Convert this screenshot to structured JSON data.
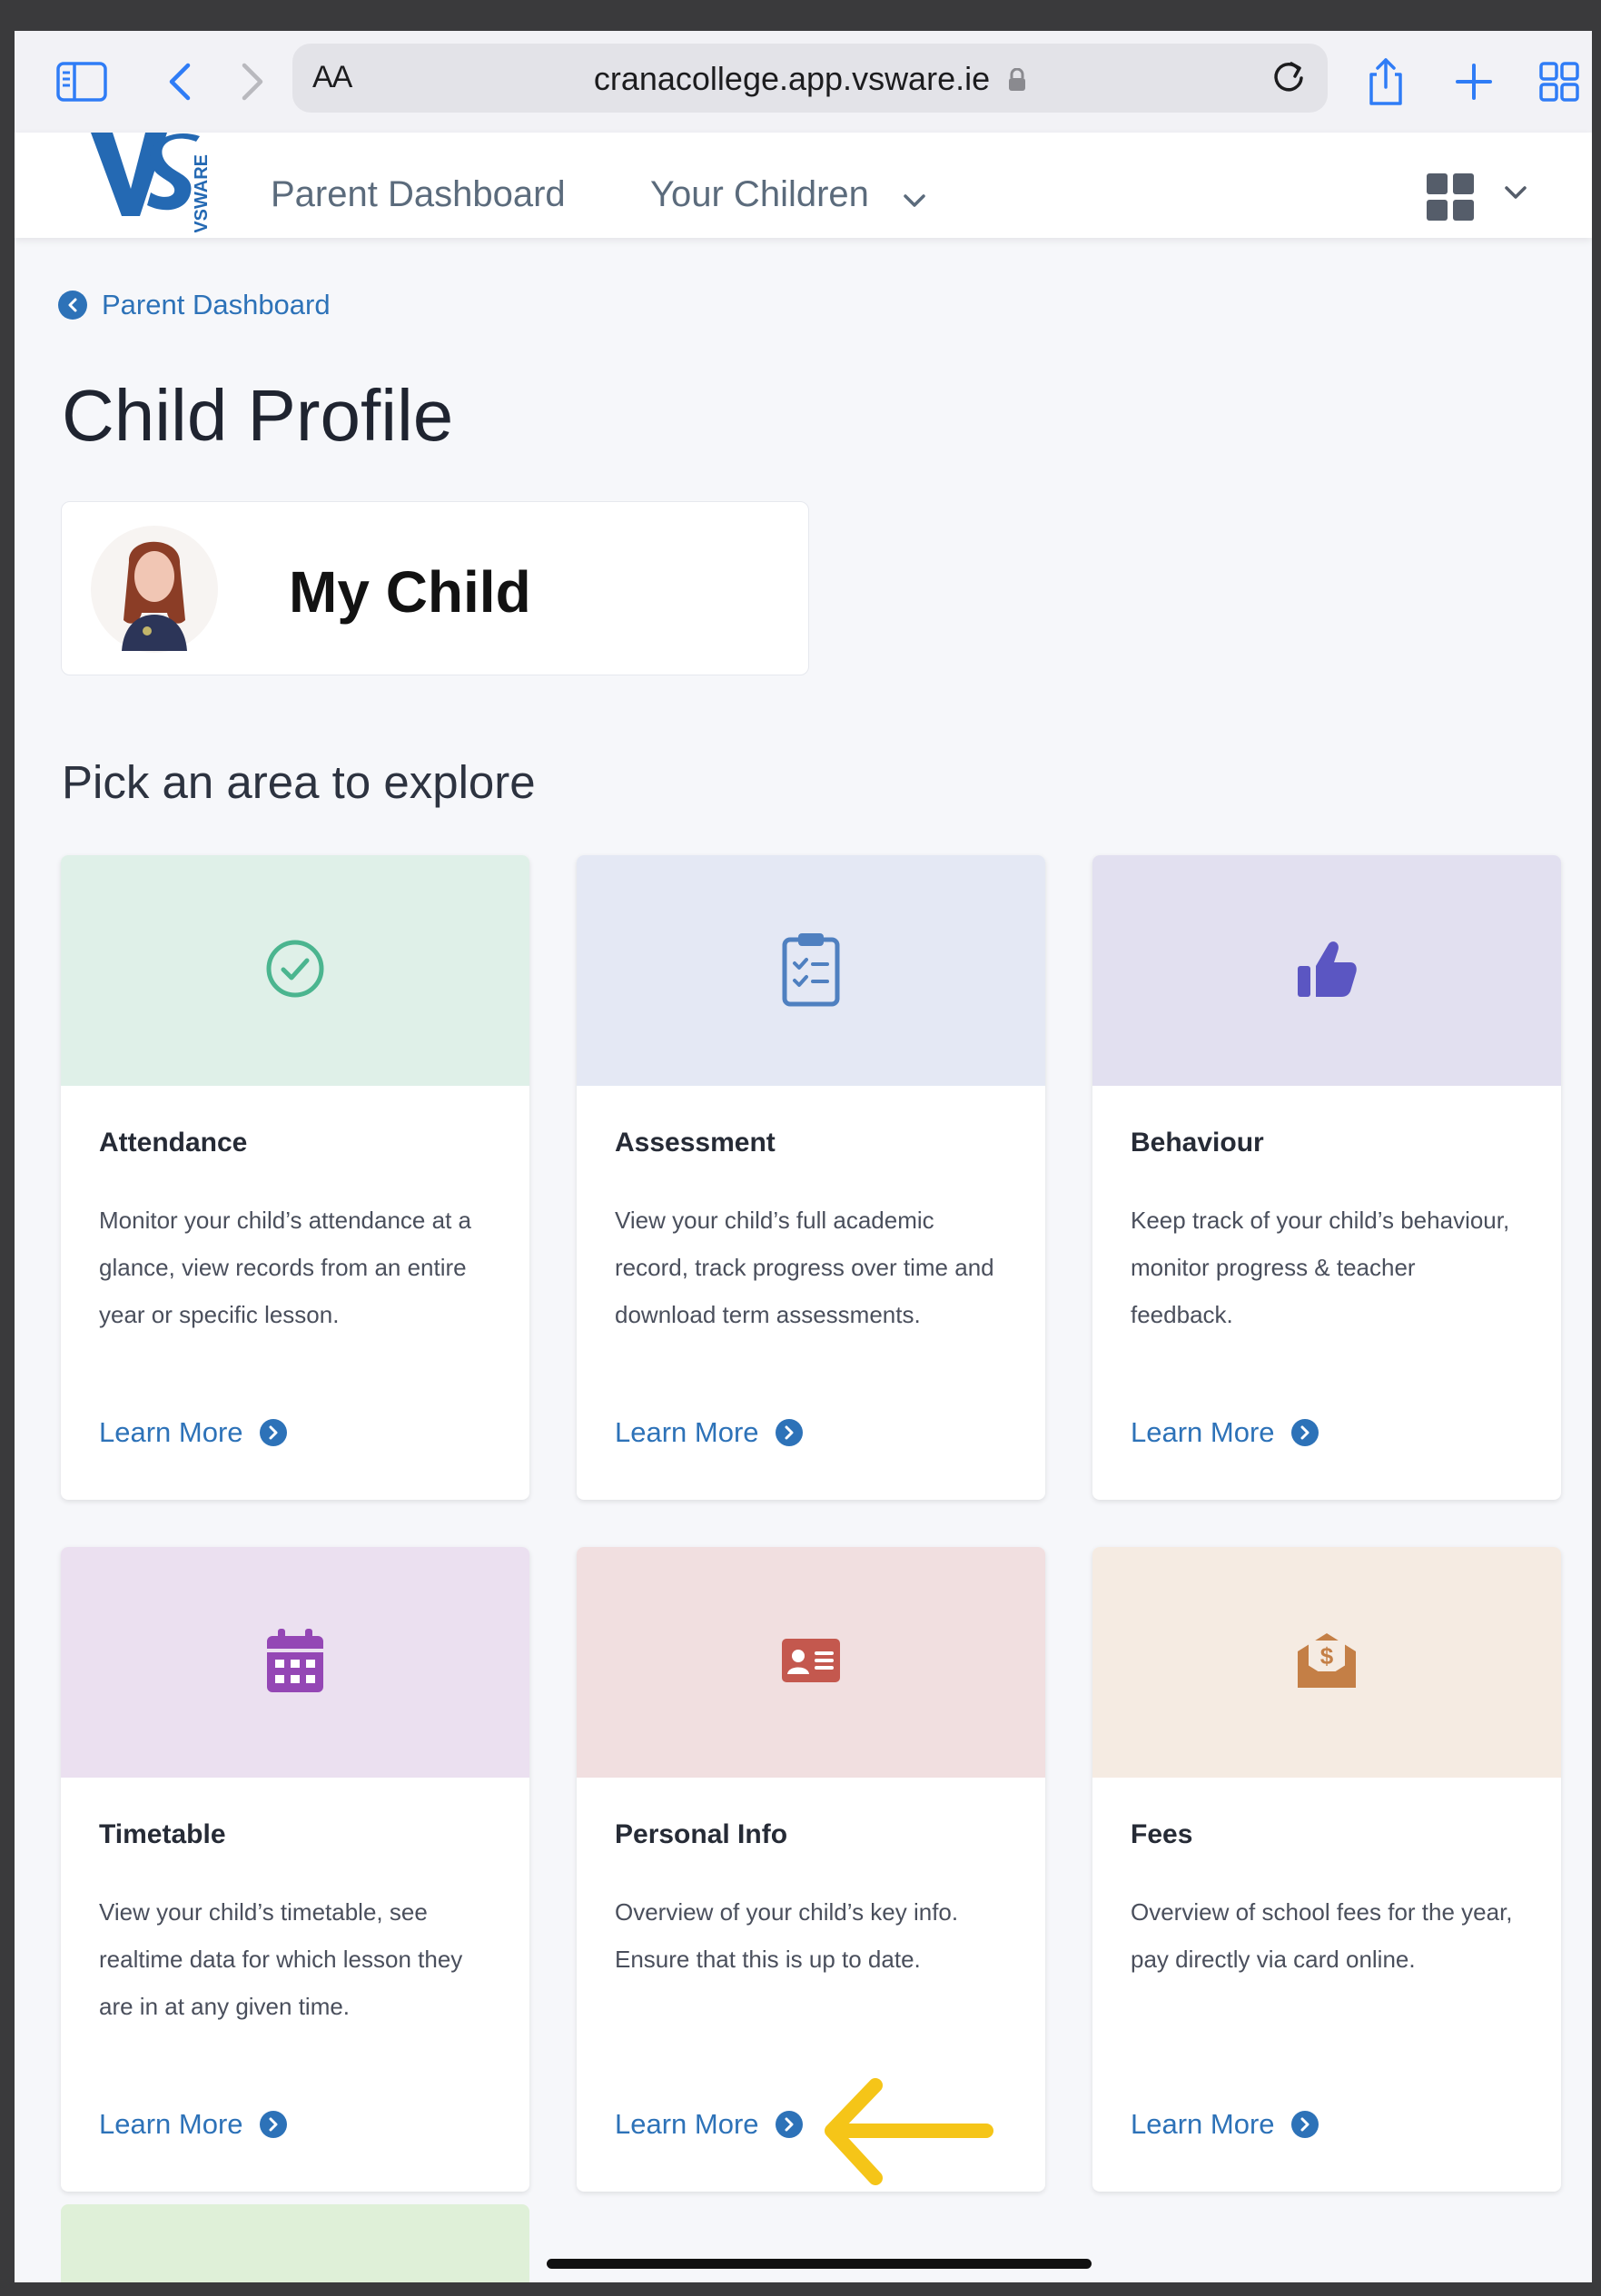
{
  "browser": {
    "text_size_label": "AA",
    "url": "cranacollege.app.vsware.ie"
  },
  "nav": {
    "logo_text": "VSWARE",
    "parent_dashboard": "Parent Dashboard",
    "your_children": "Your Children"
  },
  "breadcrumb": {
    "label": "Parent Dashboard"
  },
  "page": {
    "title": "Child Profile",
    "child_name": "My Child",
    "section_title": "Pick an area to explore"
  },
  "cards": [
    {
      "title": "Attendance",
      "description": "Monitor your child’s attendance at a glance, view records from an entire year or specific lesson.",
      "link": "Learn More",
      "icon": "check-circle-icon",
      "bg": "#dff0e8",
      "icon_color": "#4bb58f"
    },
    {
      "title": "Assessment",
      "description": "View your child’s full academic record, track progress over time and download term assessments.",
      "link": "Learn More",
      "icon": "clipboard-icon",
      "bg": "#e4e8f4",
      "icon_color": "#4f80c0"
    },
    {
      "title": "Behaviour",
      "description": "Keep track of your child’s behaviour, monitor progress & teacher feedback.",
      "link": "Learn More",
      "icon": "thumbs-up-icon",
      "bg": "#e2e0f0",
      "icon_color": "#5b56c2"
    },
    {
      "title": "Timetable",
      "description": "View your child’s timetable, see realtime data for which lesson they are in at any given time.",
      "link": "Learn More",
      "icon": "calendar-icon",
      "bg": "#ebe0f0",
      "icon_color": "#9447b5"
    },
    {
      "title": "Personal Info",
      "description": "Overview of your child’s key info. Ensure that this is up to date.",
      "link": "Learn More",
      "icon": "id-card-icon",
      "bg": "#f1dfe0",
      "icon_color": "#c4584e"
    },
    {
      "title": "Fees",
      "description": "Overview of school fees for the year, pay directly via card online.",
      "link": "Learn More",
      "icon": "money-envelope-icon",
      "bg": "#f5ebe2",
      "icon_color": "#c47f46"
    }
  ],
  "colors": {
    "link_blue": "#2d72b8",
    "annotation_arrow": "#f5c518",
    "partial_card_bg": "#dff0d8"
  }
}
